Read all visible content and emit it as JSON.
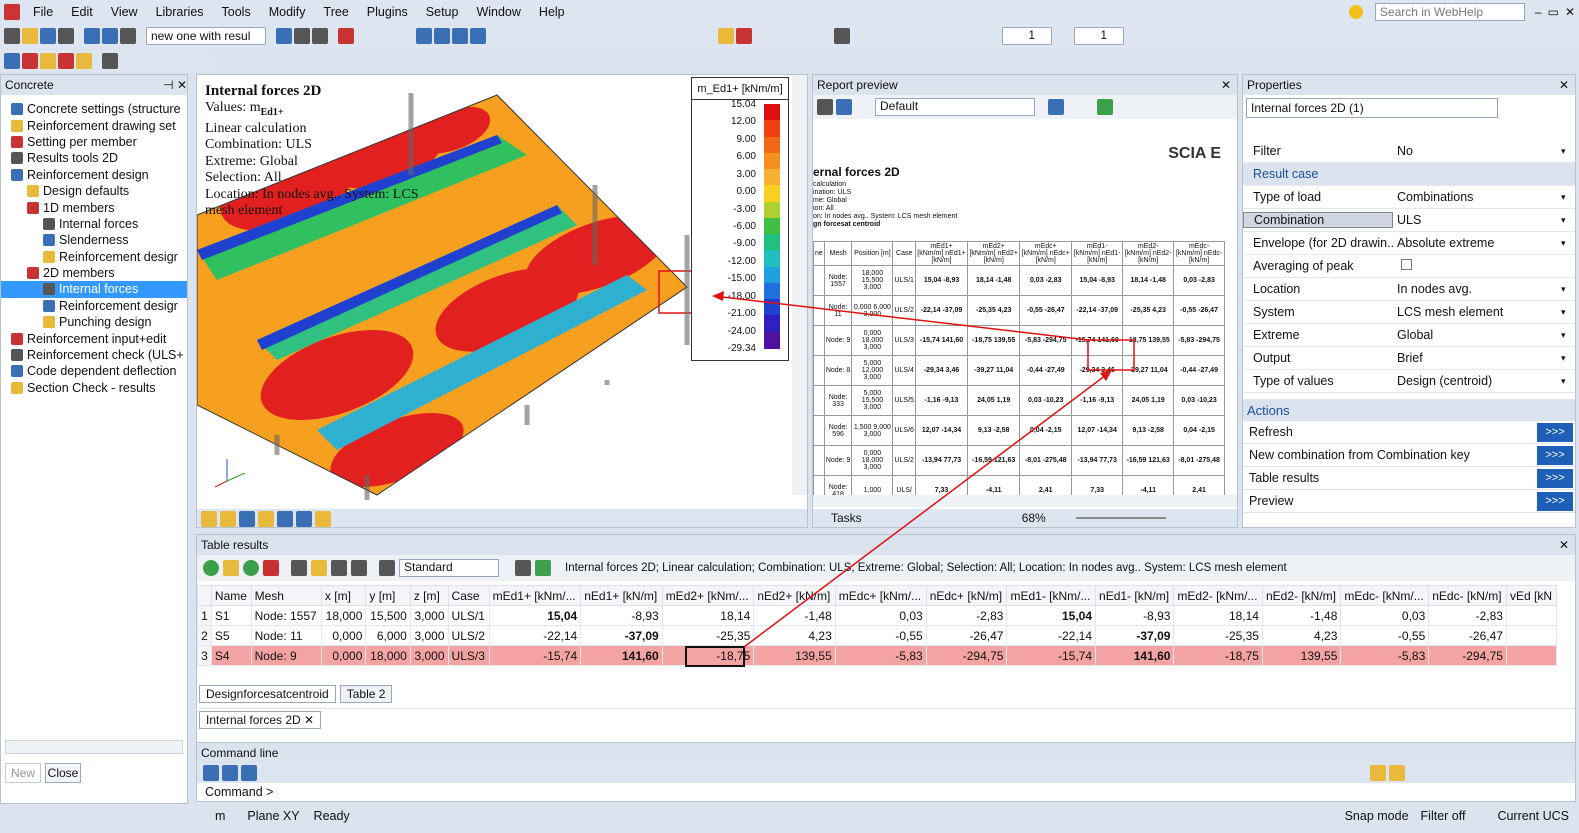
{
  "menu": [
    "File",
    "Edit",
    "View",
    "Libraries",
    "Tools",
    "Modify",
    "Tree",
    "Plugins",
    "Setup",
    "Window",
    "Help"
  ],
  "search": {
    "placeholder": "Search in WebHelp"
  },
  "toolbar": {
    "combo": "new one with resul",
    "spin1": "1",
    "spin2": "1"
  },
  "left_panel": {
    "title": "Concrete",
    "new_label": "New",
    "close_label": "Close",
    "items": [
      {
        "label": "Concrete settings (structure",
        "indent": 1,
        "icon": "settings-icon"
      },
      {
        "label": "Reinforcement drawing set",
        "indent": 1,
        "icon": "drawing-icon"
      },
      {
        "label": "Setting per member",
        "indent": 1,
        "icon": "settings-icon"
      },
      {
        "label": "Results tools 2D",
        "indent": 1,
        "icon": "results-icon"
      },
      {
        "label": "Reinforcement design",
        "indent": 1,
        "icon": "design-icon"
      },
      {
        "label": "Design defaults",
        "indent": 2,
        "icon": "defaults-icon"
      },
      {
        "label": "1D members",
        "indent": 2,
        "icon": "beam-icon"
      },
      {
        "label": "Internal forces",
        "indent": 3,
        "icon": "forces-icon"
      },
      {
        "label": "Slenderness",
        "indent": 3,
        "icon": "slenderness-icon"
      },
      {
        "label": "Reinforcement desigr",
        "indent": 3,
        "icon": "reinf-icon"
      },
      {
        "label": "2D members",
        "indent": 2,
        "icon": "plate-icon"
      },
      {
        "label": "Internal forces",
        "indent": 3,
        "icon": "forces-icon",
        "selected": true
      },
      {
        "label": "Reinforcement desigr",
        "indent": 3,
        "icon": "reinf-icon"
      },
      {
        "label": "Punching design",
        "indent": 3,
        "icon": "punch-icon"
      },
      {
        "label": "Reinforcement input+edit",
        "indent": 1,
        "icon": "input-icon"
      },
      {
        "label": "Reinforcement check (ULS+",
        "indent": 1,
        "icon": "check-icon"
      },
      {
        "label": "Code dependent deflection",
        "indent": 1,
        "icon": "deflection-icon"
      },
      {
        "label": "Section Check - results",
        "indent": 1,
        "icon": "section-icon"
      }
    ]
  },
  "view": {
    "info": [
      "Internal forces 2D",
      "Values: m",
      "Linear calculation",
      "Combination: ULS",
      "Extreme: Global",
      "Selection: All",
      "Location: In nodes avg.. System: LCS",
      "mesh element"
    ],
    "info_sub": "Ed1+",
    "legend_title": "m_Ed1+ [kNm/m]",
    "legend_values": [
      "15.04",
      "12.00",
      "9.00",
      "6.00",
      "3.00",
      "0.00",
      "-3.00",
      "-6.00",
      "-9.00",
      "-12.00",
      "-15.00",
      "-18.00",
      "-21.00",
      "-24.00",
      "-29.34"
    ],
    "legend_colors": [
      "#e01010",
      "#f04010",
      "#f06818",
      "#f59020",
      "#f7b030",
      "#f7d020",
      "#b0d030",
      "#40c040",
      "#20c080",
      "#20c0c0",
      "#20a0e0",
      "#2070e0",
      "#2040d0",
      "#3020c0",
      "#5010a0"
    ],
    "axis": [
      "z",
      "y",
      "x"
    ]
  },
  "report": {
    "title": "Report preview",
    "template": "Default",
    "logo": "SCIA E",
    "heading": "ernal forces 2D",
    "meta": [
      "calculation",
      "ination: ULS",
      "me: Global",
      "ion: All",
      "on: In nodes avg.. System: LCS mesh element",
      "gn forcesat centroid"
    ],
    "headers": [
      "ne",
      "Mesh",
      "Position [m]",
      "Case",
      "mEd1+ [kNm/m] nEd1+ [kN/m]",
      "mEd2+ [kNm/m] nEd2+ [kN/m]",
      "mEdc+ [kNm/m] nEdc+ [kN/m]",
      "mEd1- [kNm/m] nEd1- [kN/m]",
      "mEd2- [kNm/m] nEd2- [kN/m]",
      "mEdc- [kNm/m] nEdc- [kN/m]"
    ],
    "rows": [
      [
        "",
        "Node: 1557",
        "18,000 15,500 3,000",
        "ULS/1",
        "15,04 -8,93",
        "18,14 -1,48",
        "0,03 -2,83",
        "15,04 -8,93",
        "18,14 -1,48",
        "0,03 -2,83"
      ],
      [
        "",
        "Node: 11",
        "0,000 6,000 3,000",
        "ULS/2",
        "-22,14 -37,09",
        "-25,35 4,23",
        "-0,55 -26,47",
        "-22,14 -37,09",
        "-25,35 4,23",
        "-0,55 -26,47"
      ],
      [
        "",
        "Node: 9",
        "0,000 18,000 3,000",
        "ULS/3",
        "-15,74 141,60",
        "-18,75 139,55",
        "-5,83 -294,75",
        "-15,74 141,60",
        "-18,75 139,55",
        "-5,83 -294,75"
      ],
      [
        "",
        "Node: 8",
        "5,000 12,000 3,000",
        "ULS/4",
        "-29,34 3,46",
        "-39,27 11,04",
        "-0,44 -27,49",
        "-29,34 3,46",
        "-39,27 11,04",
        "-0,44 -27,49"
      ],
      [
        "",
        "Node: 333",
        "5,000 15,500 3,000",
        "ULS/5",
        "-1,16 -9,13",
        "24,05 1,19",
        "0,03 -10,23",
        "-1,16 -9,13",
        "24,05 1,19",
        "0,03 -10,23"
      ],
      [
        "",
        "Node: 596",
        "1,500 9,000 3,000",
        "ULS/6",
        "12,07 -14,34",
        "9,13 -2,58",
        "0,04 -2,15",
        "12,07 -14,34",
        "9,13 -2,58",
        "0,04 -2,15"
      ],
      [
        "",
        "Node: 9",
        "0,000 18,000 3,000",
        "ULS/2",
        "-13,94 77,73",
        "-16,59 121,63",
        "-8,01 -275,48",
        "-13,94 77,73",
        "-16,59 121,63",
        "-8,01 -275,48"
      ],
      [
        "",
        "Node: 418",
        "1,000",
        "ULS/",
        "7,33",
        "-4,11",
        "2,41",
        "7,33",
        "-4,11",
        "2,41"
      ]
    ],
    "tasks": "Tasks",
    "zoom": "68%"
  },
  "properties": {
    "title": "Properties",
    "selector": "Internal forces 2D (1)",
    "rows": [
      {
        "k": "Filter",
        "v": "No",
        "dd": true
      },
      {
        "k": "Result case",
        "v": "",
        "section": true
      },
      {
        "k": "Type of load",
        "v": "Combinations",
        "dd": true
      },
      {
        "k": "Combination",
        "v": "ULS",
        "dd": true,
        "hl": true
      },
      {
        "k": "Envelope (for 2D drawin...",
        "v": "Absolute extreme",
        "dd": true
      },
      {
        "k": "Averaging of peak",
        "v": "",
        "cb": true
      },
      {
        "k": "Location",
        "v": "In nodes avg.",
        "dd": true
      },
      {
        "k": "System",
        "v": "LCS mesh element",
        "dd": true
      },
      {
        "k": "Extreme",
        "v": "Global",
        "dd": true
      },
      {
        "k": "Output",
        "v": "Brief",
        "dd": true
      },
      {
        "k": "Type of values",
        "v": "Design (centroid)",
        "dd": true
      }
    ],
    "actions_title": "Actions",
    "actions": [
      "Refresh",
      "New combination from Combination key",
      "Table results",
      "Preview"
    ],
    "action_btn": ">>>"
  },
  "table": {
    "title": "Table results",
    "template": "Standard",
    "caption": "Internal forces 2D; Linear calculation; Combination: ULS; Extreme: Global; Selection: All; Location: In nodes avg.. System: LCS mesh element",
    "columns": [
      "",
      "Name",
      "Mesh",
      "x [m]",
      "y [m]",
      "z [m]",
      "Case",
      "mEd1+ [kNm/...",
      "nEd1+ [kN/m]",
      "mEd2+ [kNm/...",
      "nEd2+ [kN/m]",
      "mEdc+ [kNm/...",
      "nEdc+ [kN/m]",
      "mEd1- [kNm/...",
      "nEd1- [kN/m]",
      "mEd2- [kNm/...",
      "nEd2- [kN/m]",
      "mEdc- [kNm/...",
      "nEdc- [kN/m]",
      "vEd [kN"
    ],
    "rows": [
      [
        "1",
        "S1",
        "Node: 1557",
        "18,000",
        "15,500",
        "3,000",
        "ULS/1",
        "15,04",
        "-8,93",
        "18,14",
        "-1,48",
        "0,03",
        "-2,83",
        "15,04",
        "-8,93",
        "18,14",
        "-1,48",
        "0,03",
        "-2,83",
        ""
      ],
      [
        "2",
        "S5",
        "Node: 11",
        "0,000",
        "6,000",
        "3,000",
        "ULS/2",
        "-22,14",
        "-37,09",
        "-25,35",
        "4,23",
        "-0,55",
        "-26,47",
        "-22,14",
        "-37,09",
        "-25,35",
        "4,23",
        "-0,55",
        "-26,47",
        ""
      ],
      [
        "3",
        "S4",
        "Node: 9",
        "0,000",
        "18,000",
        "3,000",
        "ULS/3",
        "-15,74",
        "141,60",
        "-18,75",
        "139,55",
        "-5,83",
        "-294,75",
        "-15,74",
        "141,60",
        "-18,75",
        "139,55",
        "-5,83",
        "-294,75",
        ""
      ]
    ],
    "tabs": [
      "Designforcesatcentroid",
      "Table 2"
    ],
    "doc_tab": "Internal forces 2D"
  },
  "command": {
    "title": "Command line",
    "prompt": "Command >"
  },
  "status": {
    "unit": "m",
    "plane": "Plane XY",
    "ready": "Ready",
    "snap": "Snap mode",
    "filter": "Filter off",
    "ucs": "Current UCS"
  }
}
